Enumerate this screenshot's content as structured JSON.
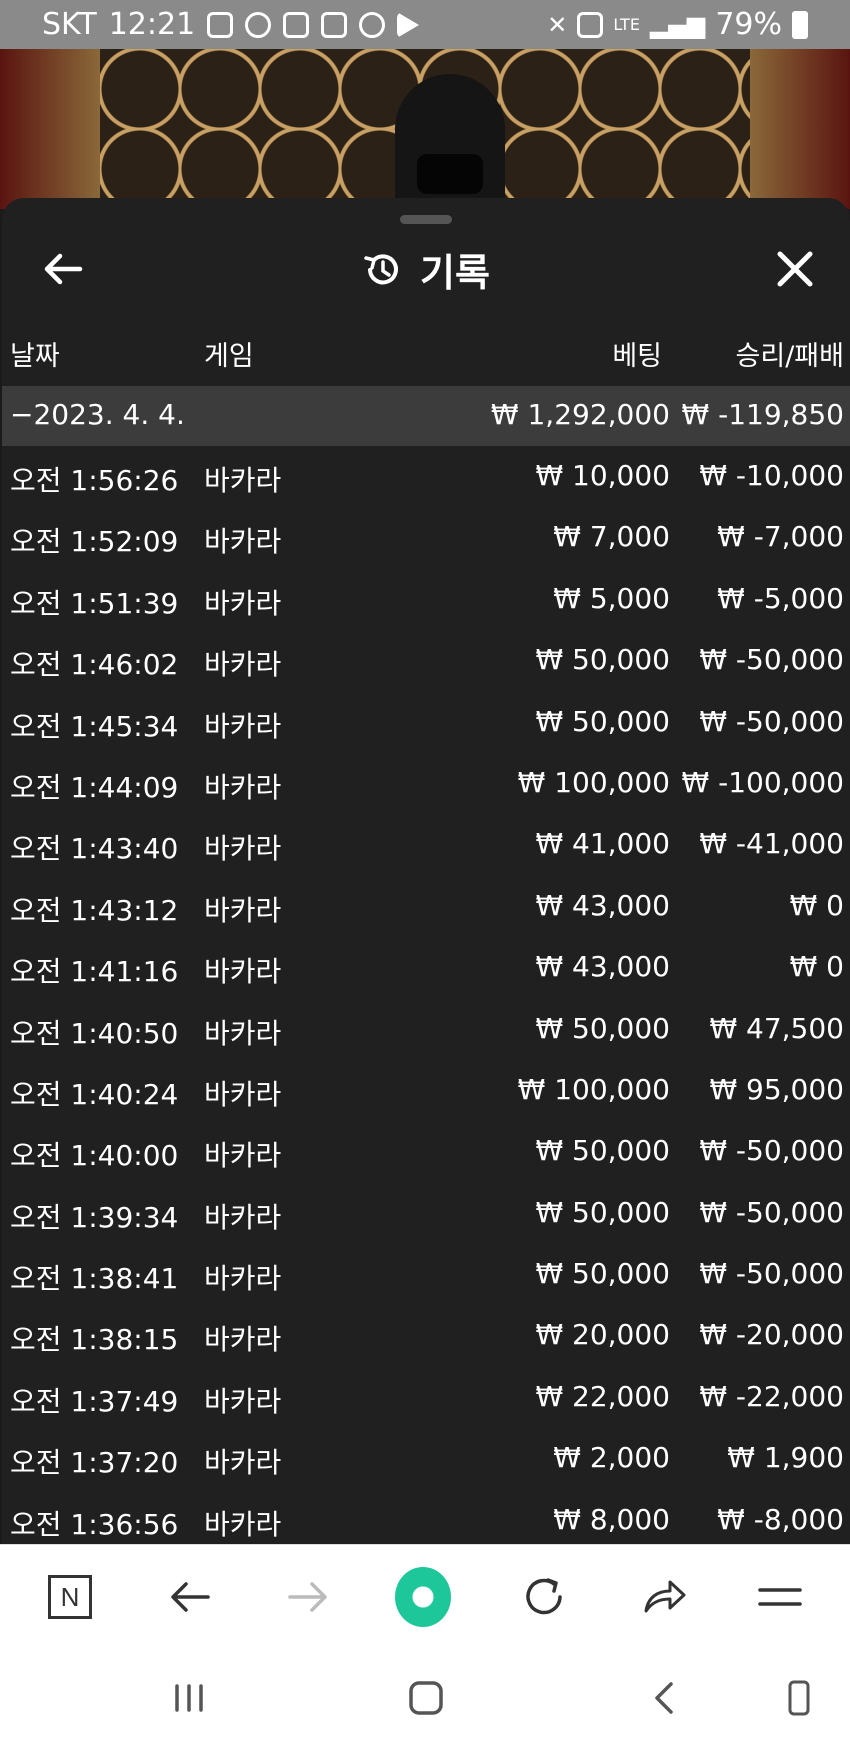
{
  "status_bar": {
    "carrier": "SKT",
    "time": "12:21",
    "network": "LTE",
    "battery": "79%"
  },
  "sheet": {
    "title": "기록",
    "headers": {
      "date": "날짜",
      "game": "게임",
      "bet": "베팅",
      "win_loss": "승리/패배"
    },
    "summary": {
      "date": "−2023. 4. 4.",
      "bet": "₩ 1,292,000",
      "win_loss": "₩ -119,850"
    },
    "rows": [
      {
        "time": "오전 1:56:26",
        "game": "바카라",
        "bet": "₩ 10,000",
        "result": "₩ -10,000"
      },
      {
        "time": "오전 1:52:09",
        "game": "바카라",
        "bet": "₩ 7,000",
        "result": "₩ -7,000"
      },
      {
        "time": "오전 1:51:39",
        "game": "바카라",
        "bet": "₩ 5,000",
        "result": "₩ -5,000"
      },
      {
        "time": "오전 1:46:02",
        "game": "바카라",
        "bet": "₩ 50,000",
        "result": "₩ -50,000"
      },
      {
        "time": "오전 1:45:34",
        "game": "바카라",
        "bet": "₩ 50,000",
        "result": "₩ -50,000"
      },
      {
        "time": "오전 1:44:09",
        "game": "바카라",
        "bet": "₩ 100,000",
        "result": "₩ -100,000"
      },
      {
        "time": "오전 1:43:40",
        "game": "바카라",
        "bet": "₩ 41,000",
        "result": "₩ -41,000"
      },
      {
        "time": "오전 1:43:12",
        "game": "바카라",
        "bet": "₩ 43,000",
        "result": "₩ 0"
      },
      {
        "time": "오전 1:41:16",
        "game": "바카라",
        "bet": "₩ 43,000",
        "result": "₩ 0"
      },
      {
        "time": "오전 1:40:50",
        "game": "바카라",
        "bet": "₩ 50,000",
        "result": "₩ 47,500"
      },
      {
        "time": "오전 1:40:24",
        "game": "바카라",
        "bet": "₩ 100,000",
        "result": "₩ 95,000"
      },
      {
        "time": "오전 1:40:00",
        "game": "바카라",
        "bet": "₩ 50,000",
        "result": "₩ -50,000"
      },
      {
        "time": "오전 1:39:34",
        "game": "바카라",
        "bet": "₩ 50,000",
        "result": "₩ -50,000"
      },
      {
        "time": "오전 1:38:41",
        "game": "바카라",
        "bet": "₩ 50,000",
        "result": "₩ -50,000"
      },
      {
        "time": "오전 1:38:15",
        "game": "바카라",
        "bet": "₩ 20,000",
        "result": "₩ -20,000"
      },
      {
        "time": "오전 1:37:49",
        "game": "바카라",
        "bet": "₩ 22,000",
        "result": "₩ -22,000"
      },
      {
        "time": "오전 1:37:20",
        "game": "바카라",
        "bet": "₩ 2,000",
        "result": "₩ 1,900"
      },
      {
        "time": "오전 1:36:56",
        "game": "바카라",
        "bet": "₩ 8,000",
        "result": "₩ -8,000"
      }
    ]
  },
  "toolbar": {
    "home_label": "N",
    "icons": [
      "naver-home-icon",
      "back-arrow-icon",
      "forward-arrow-icon",
      "green-dot-icon",
      "refresh-icon",
      "share-icon",
      "menu-icon"
    ]
  },
  "colors": {
    "sheet_bg": "#202020",
    "summary_bg": "#3c3c3c",
    "accent_green": "#1ec79a",
    "status_bar": "#8a8a8a"
  }
}
